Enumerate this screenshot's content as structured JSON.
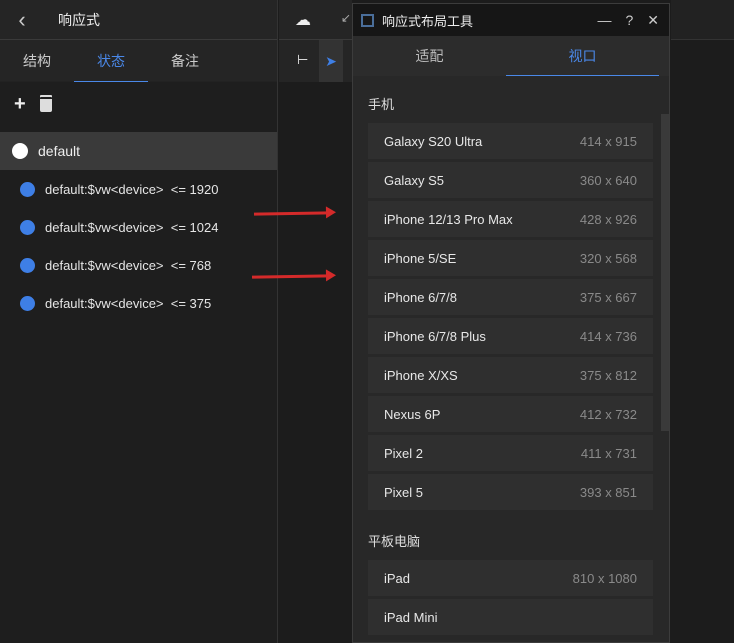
{
  "left": {
    "title": "响应式",
    "tabs": [
      "结构",
      "状态",
      "备注"
    ],
    "active_tab": 1,
    "default_label": "default",
    "states": [
      "default:$vw<device>  <= 1920",
      "default:$vw<device>  <= 1024",
      "default:$vw<device>  <= 768",
      "default:$vw<device>  <= 375"
    ]
  },
  "dialog": {
    "title": "响应式布局工具",
    "tabs": [
      "适配",
      "视口"
    ],
    "active_tab": 1,
    "sections": [
      {
        "title": "手机",
        "devices": [
          {
            "name": "Galaxy S20 Ultra",
            "size": "414 x 915"
          },
          {
            "name": "Galaxy S5",
            "size": "360 x 640"
          },
          {
            "name": "iPhone 12/13 Pro Max",
            "size": "428 x 926"
          },
          {
            "name": "iPhone 5/SE",
            "size": "320 x 568"
          },
          {
            "name": "iPhone 6/7/8",
            "size": "375 x 667"
          },
          {
            "name": "iPhone 6/7/8 Plus",
            "size": "414 x 736"
          },
          {
            "name": "iPhone X/XS",
            "size": "375 x 812"
          },
          {
            "name": "Nexus 6P",
            "size": "412 x 732"
          },
          {
            "name": "Pixel 2",
            "size": "411 x 731"
          },
          {
            "name": "Pixel 5",
            "size": "393 x 851"
          }
        ]
      },
      {
        "title": "平板电脑",
        "devices": [
          {
            "name": "iPad",
            "size": "810 x 1080"
          },
          {
            "name": "iPad Mini",
            "size": ""
          }
        ]
      }
    ]
  }
}
